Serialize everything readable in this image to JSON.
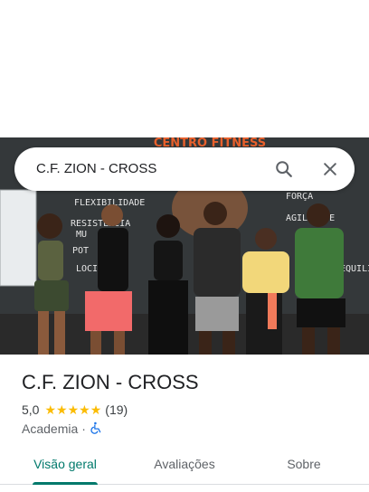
{
  "search": {
    "query": "C.F. ZION - CROSS",
    "search_icon": "search-icon",
    "close_icon": "close-icon"
  },
  "photo": {
    "wall_text": {
      "top_sign": "CENTRO FITNESS",
      "words": [
        "FLEXIBILIDADE",
        "RESISTÊNCIA",
        "MU",
        "POT",
        "LOCI",
        "FORÇA",
        "AGILIDADE",
        "EQUILÍBRIO"
      ]
    }
  },
  "place": {
    "title": "C.F. ZION - CROSS",
    "rating": "5,0",
    "stars": [
      "★",
      "★",
      "★",
      "★",
      "★"
    ],
    "review_count": "(19)",
    "category": "Academia",
    "separator": "·",
    "accessibility_icon": "wheelchair-icon"
  },
  "tabs": [
    {
      "label": "Visão geral",
      "active": true
    },
    {
      "label": "Avaliações",
      "active": false
    },
    {
      "label": "Sobre",
      "active": false
    }
  ],
  "colors": {
    "accent": "#00796b",
    "star": "#fbbc04",
    "wheelchair": "#1a73e8",
    "sign": "#e8602c"
  }
}
